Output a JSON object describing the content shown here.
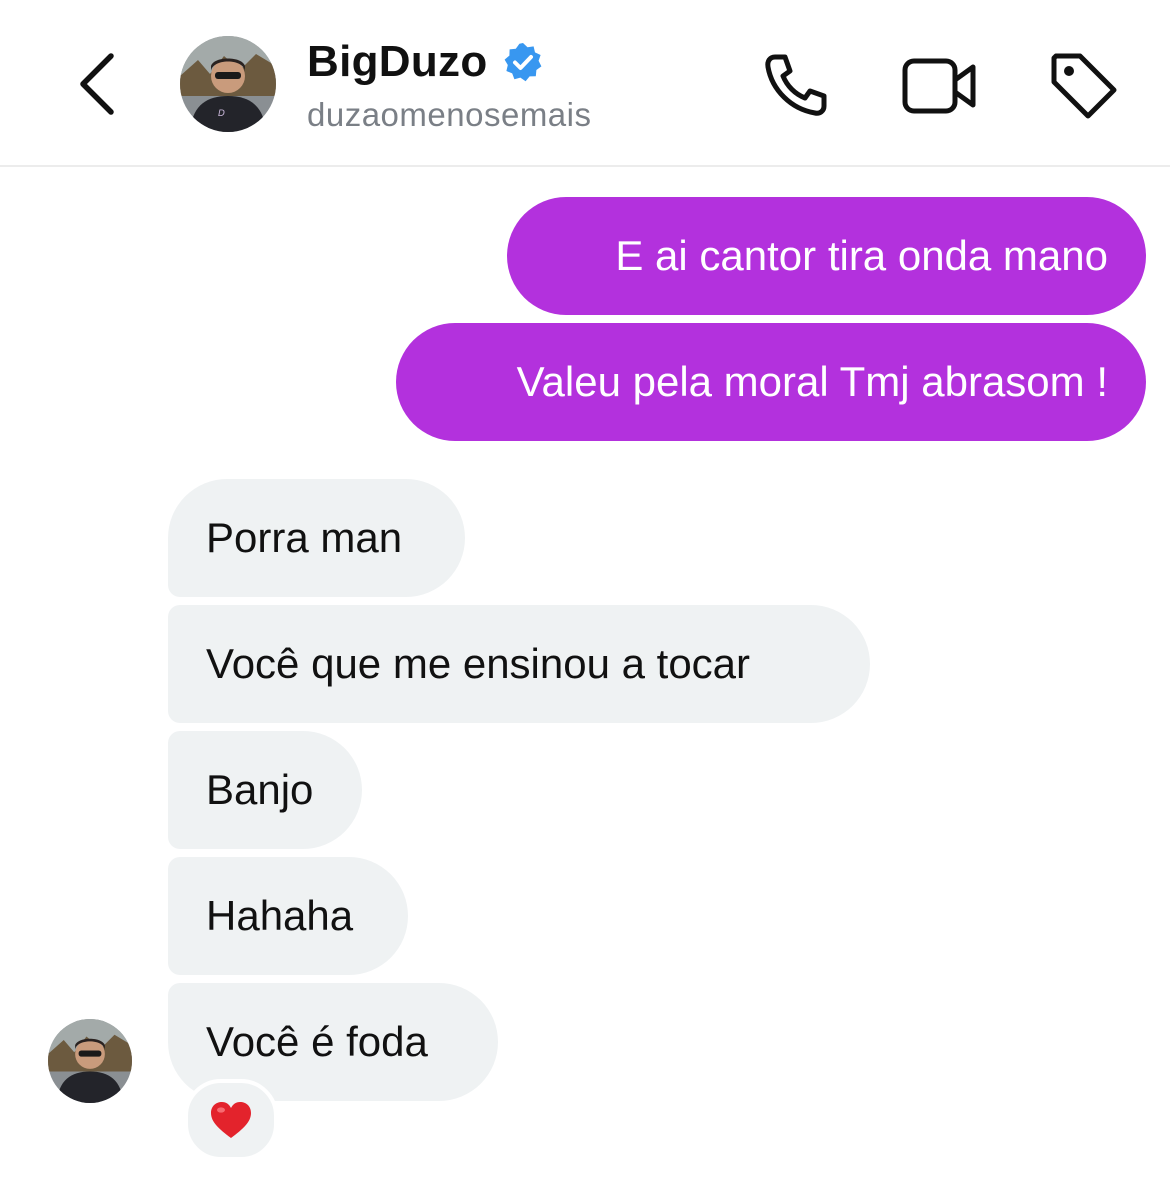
{
  "header": {
    "name": "BigDuzo",
    "verified": true,
    "username": "duzaomenosemais",
    "icons": {
      "back": "chevron-left-icon",
      "verified": "verified-badge-icon",
      "call": "phone-icon",
      "video": "video-camera-icon",
      "tag": "tag-icon"
    }
  },
  "messages": {
    "sent": [
      "E ai cantor tira onda mano",
      "Valeu pela moral Tmj abrasom !"
    ],
    "received": [
      "Porra man",
      "Você que me ensinou a tocar",
      "Banjo",
      "Hahaha",
      "Você é foda"
    ]
  },
  "reaction": {
    "emoji": "❤️",
    "icon": "heart-icon"
  },
  "colors": {
    "sent_bubble": "#b331dd",
    "received_bubble": "#eff2f3",
    "verified": "#3897f0",
    "subtitle": "#7a7f86"
  }
}
